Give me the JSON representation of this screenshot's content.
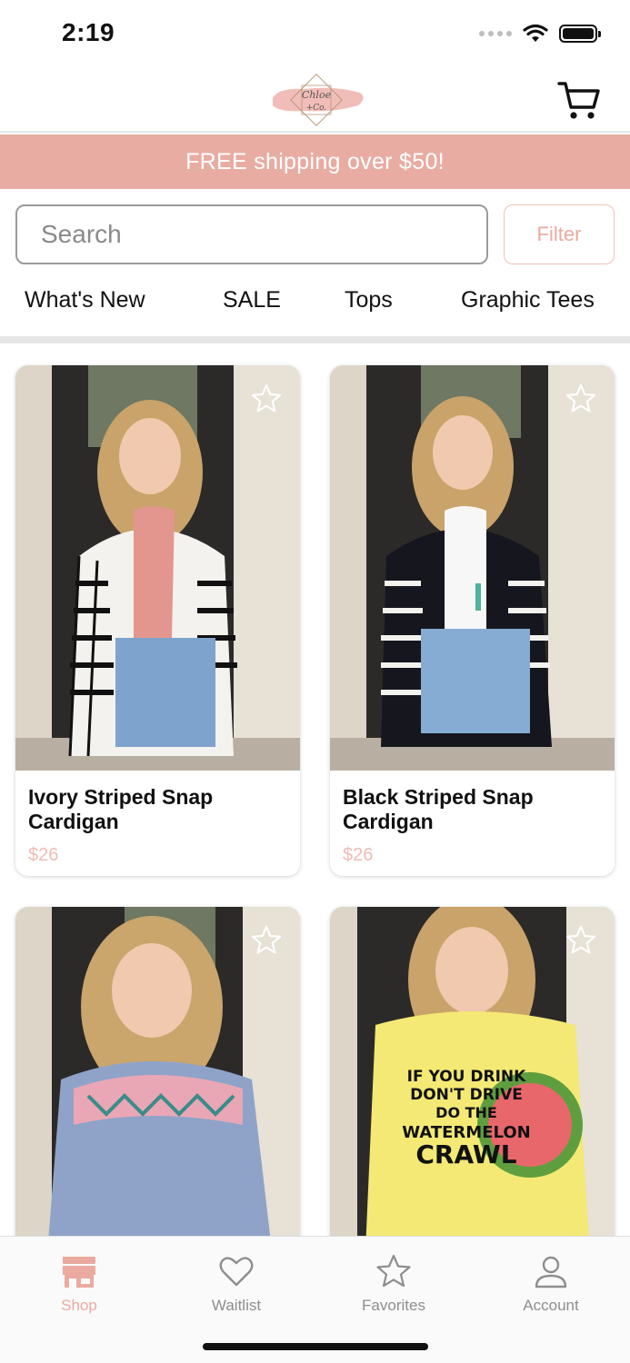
{
  "status_bar": {
    "time": "2:19"
  },
  "header": {
    "logo_text_line1": "Chloe",
    "logo_text_line2": "+Co."
  },
  "promo_banner": {
    "text": "FREE shipping over $50!"
  },
  "search": {
    "placeholder": "Search",
    "value": ""
  },
  "filter_button": {
    "label": "Filter"
  },
  "categories": [
    {
      "label": "What's New"
    },
    {
      "label": "SALE"
    },
    {
      "label": "Tops"
    },
    {
      "label": "Graphic Tees"
    }
  ],
  "products": [
    {
      "name": "Ivory Striped Snap Cardigan",
      "price": "$26",
      "favorite_icon": "star-outline-icon"
    },
    {
      "name": "Black Striped Snap Cardigan",
      "price": "$26",
      "favorite_icon": "star-outline-icon"
    },
    {
      "name": "",
      "price": "",
      "favorite_icon": "star-outline-icon"
    },
    {
      "name": "",
      "price": "",
      "favorite_icon": "star-outline-icon",
      "shirt_print": [
        "IF YOU DRINK",
        "DON'T DRIVE",
        "DO THE",
        "WATERMELON",
        "CRAWL"
      ]
    }
  ],
  "tab_bar": {
    "tabs": [
      {
        "label": "Shop",
        "icon": "storefront-icon",
        "active": true
      },
      {
        "label": "Waitlist",
        "icon": "heart-icon",
        "active": false
      },
      {
        "label": "Favorites",
        "icon": "star-icon",
        "active": false
      },
      {
        "label": "Account",
        "icon": "person-icon",
        "active": false
      }
    ]
  },
  "colors": {
    "accent": "#e8aca3",
    "accent_text": "#ebaaa0",
    "price": "#efbcb4",
    "tab_inactive": "#8e8e8e"
  }
}
